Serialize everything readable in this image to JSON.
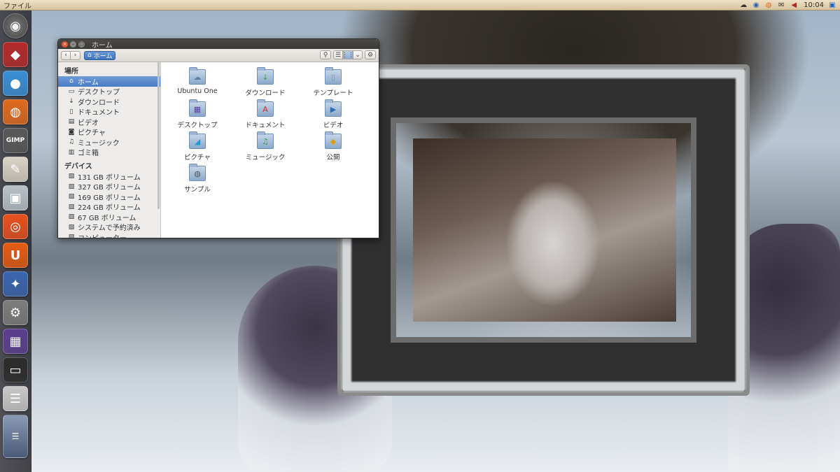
{
  "top_panel": {
    "menu": "ファイル",
    "clock": "10:04",
    "tray_icons": [
      "cloud-icon",
      "firefox-icon",
      "update-icon",
      "mail-icon",
      "volume-icon",
      "network-icon"
    ]
  },
  "launcher": {
    "items": [
      {
        "name": "dash-home-icon",
        "glyph": "◉"
      },
      {
        "name": "app-blue-shield-icon",
        "glyph": "◆"
      },
      {
        "name": "chromium-icon",
        "glyph": "●"
      },
      {
        "name": "firefox-icon",
        "glyph": "◍"
      },
      {
        "name": "gimp-icon",
        "glyph": "GIMP"
      },
      {
        "name": "text-editor-icon",
        "glyph": "✎"
      },
      {
        "name": "photo-viewer-icon",
        "glyph": "▣"
      },
      {
        "name": "disc-burner-icon",
        "glyph": "◎"
      },
      {
        "name": "ubuntu-one-icon",
        "glyph": "U"
      },
      {
        "name": "system-utility-icon",
        "glyph": "✦"
      },
      {
        "name": "settings-gear-icon",
        "glyph": "⚙"
      },
      {
        "name": "wallpaper-icon",
        "glyph": "▦"
      },
      {
        "name": "terminal-icon",
        "glyph": "▭"
      },
      {
        "name": "system-monitor-icon",
        "glyph": "☰"
      },
      {
        "name": "trash-icon",
        "glyph": "☰"
      }
    ]
  },
  "window": {
    "title": "ホーム",
    "path_button": "ホーム"
  },
  "sidebar": {
    "places_header": "場所",
    "places": [
      {
        "label": "ホーム",
        "icon": "⌂",
        "selected": true
      },
      {
        "label": "デスクトップ",
        "icon": "▭"
      },
      {
        "label": "ダウンロード",
        "icon": "↓"
      },
      {
        "label": "ドキュメント",
        "icon": "▯"
      },
      {
        "label": "ビデオ",
        "icon": "▤"
      },
      {
        "label": "ピクチャ",
        "icon": "◙"
      },
      {
        "label": "ミュージック",
        "icon": "♫"
      },
      {
        "label": "ゴミ箱",
        "icon": "▥"
      }
    ],
    "devices_header": "デバイス",
    "devices": [
      {
        "label": "131 GB ボリューム",
        "icon": "▧"
      },
      {
        "label": "327 GB ボリューム",
        "icon": "▧"
      },
      {
        "label": "169 GB ボリューム",
        "icon": "▧"
      },
      {
        "label": "224 GB ボリューム",
        "icon": "▧"
      },
      {
        "label": "67 GB ボリューム",
        "icon": "▧"
      },
      {
        "label": "システムで予約済み",
        "icon": "▧"
      },
      {
        "label": "コンピューター",
        "icon": "▧"
      }
    ]
  },
  "files": [
    {
      "label": "Ubuntu One",
      "emblem": "☁"
    },
    {
      "label": "ダウンロード",
      "emblem": "↓"
    },
    {
      "label": "テンプレート",
      "emblem": "▯"
    },
    {
      "label": "デスクトップ",
      "emblem": "▦"
    },
    {
      "label": "ドキュメント",
      "emblem": "A"
    },
    {
      "label": "ビデオ",
      "emblem": "▶"
    },
    {
      "label": "ピクチャ",
      "emblem": "◢"
    },
    {
      "label": "ミュージック",
      "emblem": "♫"
    },
    {
      "label": "公開",
      "emblem": "◆"
    },
    {
      "label": "サンプル",
      "emblem": "◍"
    }
  ]
}
